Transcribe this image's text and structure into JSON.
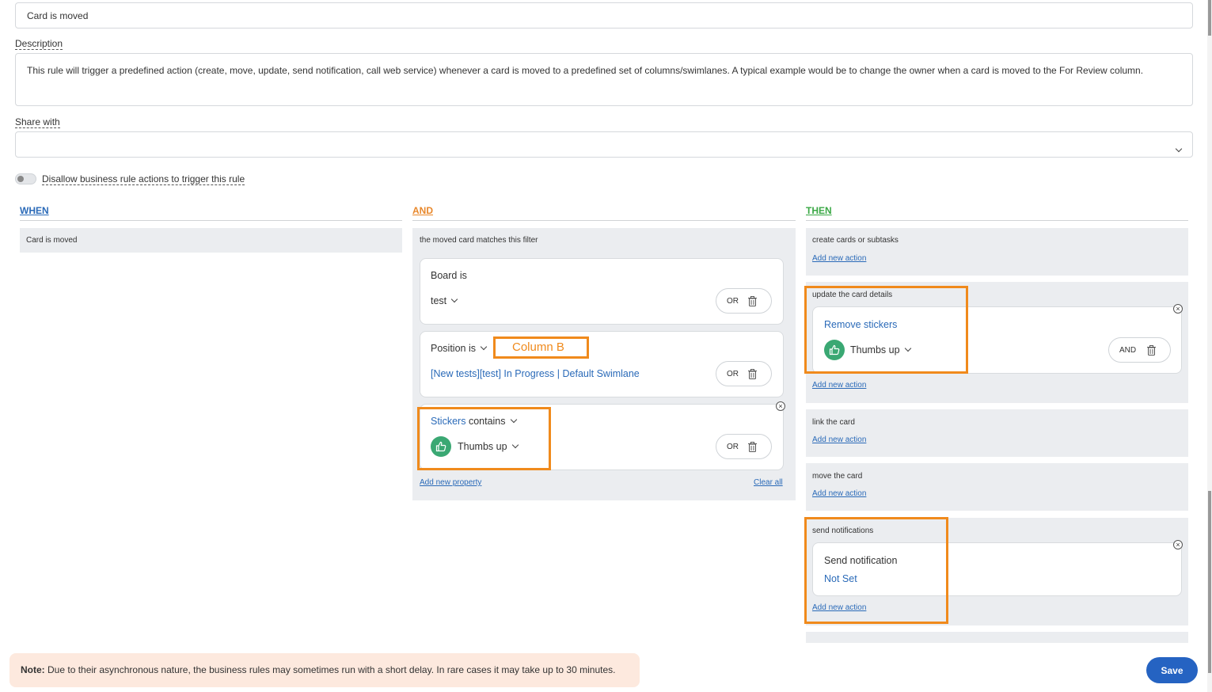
{
  "title_input": {
    "value": "Card is moved"
  },
  "description": {
    "label": "Description",
    "value": "This rule will trigger a predefined action (create, move, update, send notification, call web service) whenever a card is moved to a predefined set of columns/swimlanes. A typical example would be to change the owner when a card is moved to the For Review column."
  },
  "share_with": {
    "label": "Share with",
    "value": ""
  },
  "toggle": {
    "label": "Disallow business rule actions to trigger this rule",
    "on": false
  },
  "when": {
    "header": "WHEN",
    "color": "#2a6ab8",
    "trigger": "Card is moved"
  },
  "and": {
    "header": "AND",
    "color": "#e8872a",
    "title": "the moved card matches this filter",
    "board": {
      "label": "Board is",
      "value": "test",
      "op": "OR"
    },
    "position": {
      "label": "Position is",
      "annotation": "Column B",
      "value": "[New tests][test] In Progress | Default Swimlane",
      "op": "OR"
    },
    "stickers": {
      "label_link": "Stickers",
      "label_rest": "contains",
      "value": "Thumbs up",
      "op": "OR"
    },
    "add_property": "Add new property",
    "clear_all": "Clear all"
  },
  "then": {
    "header": "THEN",
    "color": "#3aa845",
    "sections": {
      "create": {
        "title": "create cards or subtasks",
        "add": "Add new action"
      },
      "update": {
        "title": "update the card details",
        "action": "Remove stickers",
        "value": "Thumbs up",
        "op": "AND",
        "add": "Add new action"
      },
      "link": {
        "title": "link the card",
        "add": "Add new action"
      },
      "move": {
        "title": "move the card",
        "add": "Add new action"
      },
      "notify": {
        "title": "send notifications",
        "action": "Send notification",
        "value": "Not Set",
        "add": "Add new action"
      }
    }
  },
  "note": {
    "bold": "Note:",
    "text": " Due to their asynchronous nature, the business rules may sometimes run with a short delay. In rare cases it may take up to 30 minutes."
  },
  "save_label": "Save"
}
